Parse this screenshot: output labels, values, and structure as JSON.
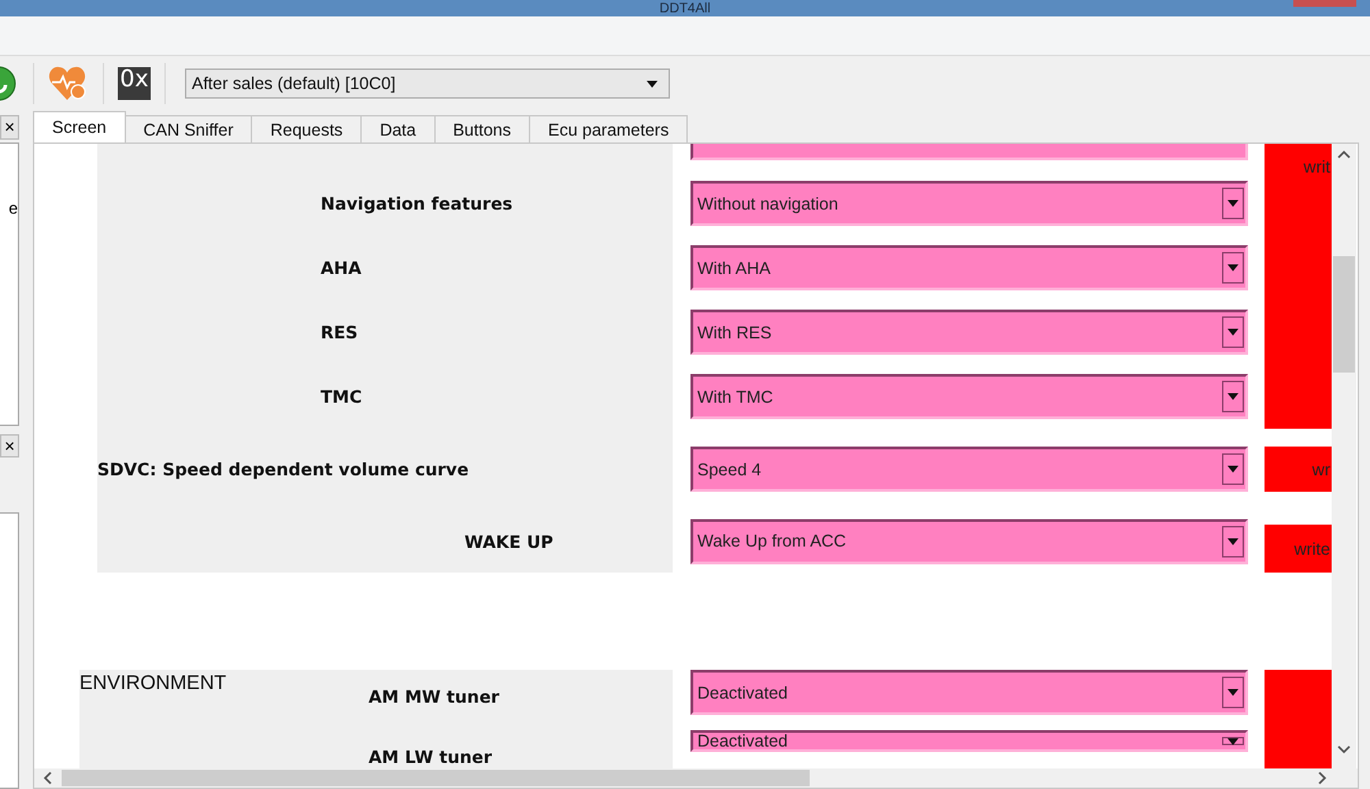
{
  "window": {
    "title": "DDT4All"
  },
  "toolbar": {
    "hex_label": "0x",
    "mode_select": "After sales (default) [10C0]"
  },
  "left_panel": {
    "text": "e",
    "close_buttons": [
      "×",
      "×"
    ]
  },
  "tabs": [
    {
      "label": "Screen",
      "selected": true
    },
    {
      "label": "CAN Sniffer",
      "selected": false
    },
    {
      "label": "Requests",
      "selected": false
    },
    {
      "label": "Data",
      "selected": false
    },
    {
      "label": "Buttons",
      "selected": false
    },
    {
      "label": "Ecu parameters",
      "selected": false
    }
  ],
  "groups": [
    {
      "write": "writ",
      "rows": [
        {
          "label": "Navigation features",
          "value": "Without navigation"
        },
        {
          "label": "AHA",
          "value": "With AHA"
        },
        {
          "label": "RES",
          "value": "With RES"
        },
        {
          "label": "TMC",
          "value": "With TMC"
        }
      ]
    },
    {
      "write": "wr",
      "rows": [
        {
          "label": "SDVC: Speed dependent volume curve",
          "value": "Speed 4"
        }
      ]
    },
    {
      "write": "write",
      "rows": [
        {
          "label": "WAKE UP",
          "value": "Wake Up from ACC"
        }
      ]
    },
    {
      "title": "ENVIRONMENT",
      "rows": [
        {
          "label": "AM MW tuner",
          "value": "Deactivated"
        },
        {
          "label": "AM LW tuner",
          "value": "Deactivated"
        }
      ]
    }
  ]
}
